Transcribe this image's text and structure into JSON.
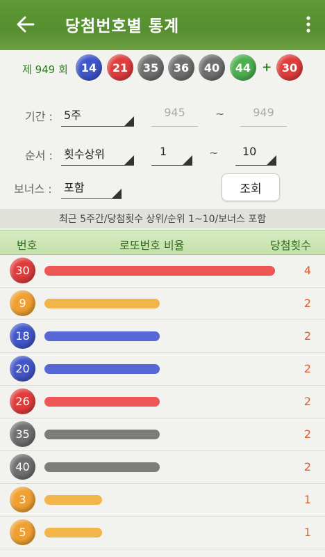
{
  "app_bar": {
    "title": "당첨번호별 통계"
  },
  "draw": {
    "round_label": "제 949 회",
    "numbers": [
      {
        "value": "14",
        "color": "#3d56c9"
      },
      {
        "value": "21",
        "color": "#e03c3c"
      },
      {
        "value": "35",
        "color": "#6f6f6f"
      },
      {
        "value": "36",
        "color": "#6f6f6f"
      },
      {
        "value": "40",
        "color": "#6f6f6f"
      },
      {
        "value": "44",
        "color": "#4caf50"
      }
    ],
    "plus": "+",
    "bonus": {
      "value": "30",
      "color": "#e03c3c"
    }
  },
  "filters": {
    "period_label": "기간 :",
    "period_value": "5주",
    "period_from": "945",
    "period_to": "949",
    "order_label": "순서 :",
    "order_value": "횟수상위",
    "order_from": "1",
    "order_to": "10",
    "bonus_label": "보너스 :",
    "bonus_value": "포함",
    "tilde": "~",
    "search_button": "조회"
  },
  "summary": "최근 5주간/당첨횟수 상위/순위 1~10/보너스 포함",
  "table": {
    "headers": {
      "number": "번호",
      "ratio": "로또번호 비율",
      "count": "당첨횟수"
    },
    "max_count": 4,
    "rows": [
      {
        "number": "30",
        "count": 4,
        "ball_color": "#e03c3c",
        "bar_color": "#ee5656"
      },
      {
        "number": "9",
        "count": 2,
        "ball_color": "#f0a030",
        "bar_color": "#f2b54a"
      },
      {
        "number": "18",
        "count": 2,
        "ball_color": "#4156c9",
        "bar_color": "#5867d6"
      },
      {
        "number": "20",
        "count": 2,
        "ball_color": "#4156c9",
        "bar_color": "#5867d6"
      },
      {
        "number": "26",
        "count": 2,
        "ball_color": "#e03c3c",
        "bar_color": "#ee5656"
      },
      {
        "number": "35",
        "count": 2,
        "ball_color": "#6f6f6f",
        "bar_color": "#7c7c7c"
      },
      {
        "number": "40",
        "count": 2,
        "ball_color": "#6f6f6f",
        "bar_color": "#7c7c7c"
      },
      {
        "number": "3",
        "count": 1,
        "ball_color": "#f0a030",
        "bar_color": "#f2b54a"
      },
      {
        "number": "5",
        "count": 1,
        "ball_color": "#f0a030",
        "bar_color": "#f2b54a"
      }
    ]
  }
}
